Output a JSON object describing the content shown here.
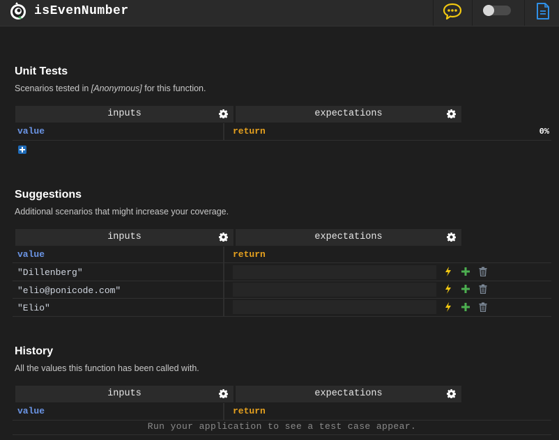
{
  "header": {
    "title": "isEvenNumber",
    "logo_icon": "ponicode-logo-icon",
    "chat_icon": "chat-bubble-icon",
    "doc_icon": "document-icon",
    "toggle_on": false
  },
  "columns": {
    "inputs": "inputs",
    "expectations": "expectations"
  },
  "unit_tests": {
    "title": "Unit Tests",
    "subtitle_prefix": "Scenarios tested in ",
    "subtitle_em": "[Anonymous]",
    "subtitle_suffix": " for this function.",
    "input_label": "value",
    "output_label": "return",
    "coverage": "0%"
  },
  "suggestions": {
    "title": "Suggestions",
    "subtitle": "Additional scenarios that might increase your coverage.",
    "input_label": "value",
    "output_label": "return",
    "rows": [
      {
        "value": "\"Dillenberg\"",
        "return": ""
      },
      {
        "value": "\"elio@ponicode.com\"",
        "return": ""
      },
      {
        "value": "\"Elio\"",
        "return": ""
      }
    ]
  },
  "history": {
    "title": "History",
    "subtitle": "All the values this function has been called with.",
    "input_label": "value",
    "output_label": "return",
    "empty_message": "Run your application to see a test case appear."
  },
  "colors": {
    "input_label": "#6b95e6",
    "return_label": "#e6a11e",
    "run_icon": "#f2c811",
    "add_icon": "#4caf50",
    "add_test": "#1f6bb8"
  }
}
